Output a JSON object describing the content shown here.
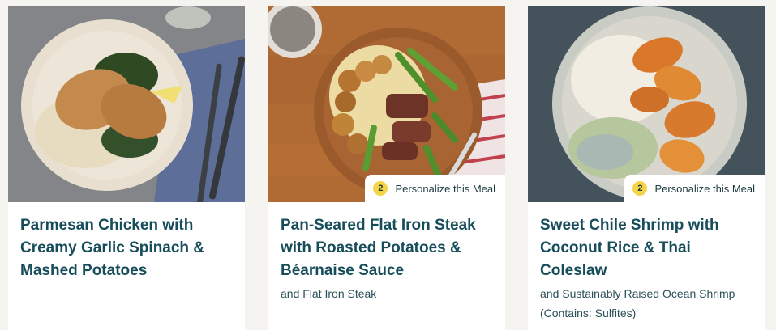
{
  "meals": [
    {
      "title": "Parmesan Chicken with Creamy Garlic Spinach & Mashed Potatoes",
      "subtitle": "",
      "image": "parmesan-chicken-photo"
    },
    {
      "title": "Pan-Seared Flat Iron Steak with Roasted Potatoes & Béarnaise Sauce",
      "subtitle": "and Flat Iron Steak",
      "image": "flat-iron-steak-photo",
      "personalize": {
        "count": "2",
        "label": "Personalize this Meal"
      }
    },
    {
      "title": "Sweet Chile Shrimp with Coconut Rice & Thai Coleslaw",
      "subtitle": "and Sustainably Raised Ocean Shrimp (Contains: Sulfites)",
      "image": "chile-shrimp-photo",
      "personalize": {
        "count": "2",
        "label": "Personalize this Meal"
      }
    }
  ],
  "colors": {
    "title": "#174d5b",
    "badge": "#f5d547",
    "background": "#f6f4f1"
  }
}
